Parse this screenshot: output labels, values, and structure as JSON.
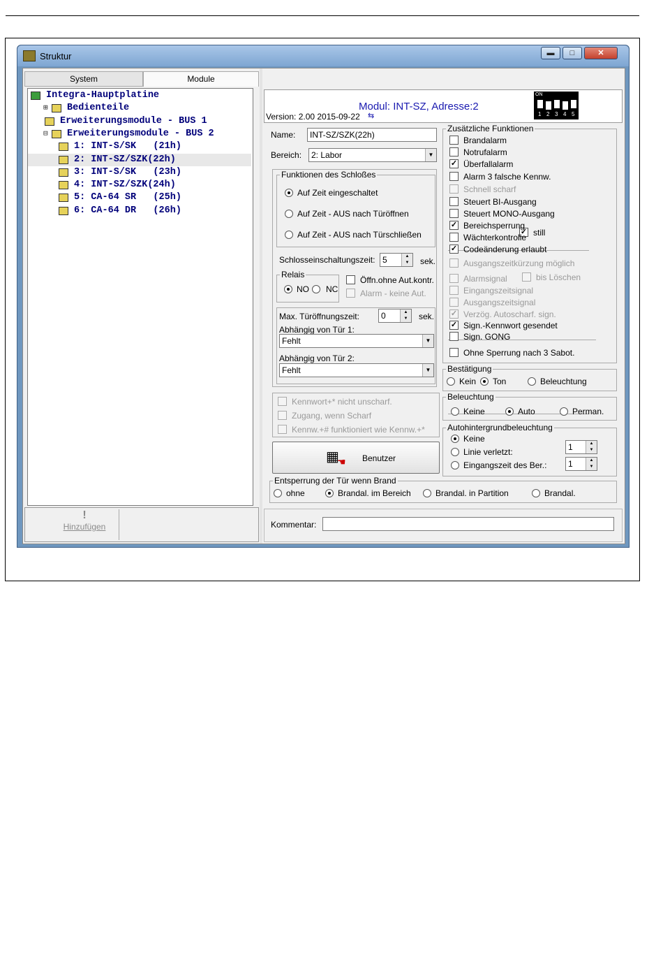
{
  "window": {
    "title": "Struktur",
    "min": "▬",
    "max": "□",
    "close": "✕"
  },
  "tabs": [
    "System",
    "Module"
  ],
  "tree": [
    {
      "text": "Integra-Hauptplatine",
      "icon": "mainboard-icon",
      "prefix": ""
    },
    {
      "text": "Bedienteile",
      "icon": "keypad-icon",
      "prefix": "⊞"
    },
    {
      "text": "Erweiterungsmodule - BUS 1",
      "icon": "bus-icon",
      "prefix": ""
    },
    {
      "text": "Erweiterungsmodule - BUS 2",
      "icon": "bus-icon",
      "prefix": "⊟"
    },
    {
      "text": "1: INT-S/SK   (21h)",
      "icon": "module-icon",
      "prefix": ""
    },
    {
      "text": "2: INT-SZ/SZK(22h)",
      "icon": "module-lock-icon",
      "prefix": ""
    },
    {
      "text": "3: INT-S/SK   (23h)",
      "icon": "module-icon",
      "prefix": ""
    },
    {
      "text": "4: INT-SZ/SZK(24h)",
      "icon": "module-lock-icon",
      "prefix": ""
    },
    {
      "text": "5: CA-64 SR   (25h)",
      "icon": "siren-icon",
      "prefix": ""
    },
    {
      "text": "6: CA-64 DR   (26h)",
      "icon": "door-icon",
      "prefix": ""
    }
  ],
  "add_button": "Hinzufügen",
  "header": {
    "module": "Modul: INT-SZ, Adresse:2",
    "version": "Version: 2.00 2015-09-22",
    "dip_on": "ON",
    "dip_numbers": [
      "1",
      "2",
      "3",
      "4",
      "5"
    ]
  },
  "name": {
    "label": "Name:",
    "value": "INT-SZ/SZK(22h)"
  },
  "bereich": {
    "label": "Bereich:",
    "value": "2: Labor"
  },
  "lockfunc": {
    "title": "Funktionen des Schloßes",
    "options": [
      "Auf Zeit eingeschaltet",
      "Auf Zeit - AUS nach Türöffnen",
      "Auf Zeit - AUS nach Türschließen"
    ],
    "selected": 0
  },
  "lock_time": {
    "label": "Schlosseinschaltungszeit:",
    "value": "5",
    "unit": "sek."
  },
  "relais": {
    "title": "Relais",
    "no": "NO",
    "nc": "NC",
    "opt1": "Öffn.ohne Aut.kontr.",
    "opt2": "Alarm - keine Aut."
  },
  "door": {
    "label": "Max. Türöffnungszeit:",
    "value": "0",
    "unit": "sek.",
    "dep1_label": "Abhängig von Tür 1:",
    "dep1": "Fehlt",
    "dep2_label": "Abhängig von Tür 2:",
    "dep2": "Fehlt"
  },
  "lowchecks": [
    "Kennwort+* nicht unscharf.",
    "Zugang, wenn Scharf",
    "Kennw.+# funktioniert wie Kennw.+*"
  ],
  "benutzer": "Benutzer",
  "zf": {
    "title": "Zusätzliche Funktionen",
    "items": [
      {
        "label": "Brandalarm",
        "checked": false,
        "disabled": false
      },
      {
        "label": "Notrufalarm",
        "checked": false,
        "disabled": false
      },
      {
        "label": "Überfallalarm",
        "checked": true,
        "disabled": false
      },
      {
        "label": "Alarm 3 falsche Kennw.",
        "checked": false,
        "disabled": false
      },
      {
        "label": "Schnell scharf",
        "checked": false,
        "disabled": true
      },
      {
        "label": "Steuert BI-Ausgang",
        "checked": false,
        "disabled": false
      },
      {
        "label": "Steuert MONO-Ausgang",
        "checked": false,
        "disabled": false
      },
      {
        "label": "Bereichsperrung",
        "checked": true,
        "disabled": false
      },
      {
        "label": "Wächterkontrolle",
        "checked": false,
        "disabled": false
      },
      {
        "label": "Codeänderung erlaubt",
        "checked": true,
        "disabled": false
      },
      {
        "label": "Ausgangszeitkürzung möglich",
        "checked": false,
        "disabled": true
      },
      {
        "label": "Alarmsignal",
        "checked": false,
        "disabled": true
      },
      {
        "label": "Eingangszeitsignal",
        "checked": false,
        "disabled": true
      },
      {
        "label": "Ausgangszeitsignal",
        "checked": false,
        "disabled": true
      },
      {
        "label": "Verzög. Autoscharf. sign.",
        "checked": true,
        "disabled": true
      },
      {
        "label": "Sign.-Kennwort gesendet",
        "checked": true,
        "disabled": false
      },
      {
        "label": "Sign. GONG",
        "checked": false,
        "disabled": false
      },
      {
        "label": "Ohne Sperrung nach 3 Sabot.",
        "checked": false,
        "disabled": false
      }
    ],
    "still": "still",
    "bis_loeschen": "bis Löschen"
  },
  "bestaetigung": {
    "title": "Bestätigung",
    "options": [
      "Kein",
      "Ton",
      "Beleuchtung"
    ],
    "selected": 1
  },
  "beleuchtung": {
    "title": "Beleuchtung",
    "options": [
      "Keine",
      "Auto",
      "Perman."
    ],
    "selected": 1
  },
  "autobg": {
    "title": "Autohintergrundbeleuchtung",
    "options": [
      "Keine",
      "Linie verletzt:",
      "Eingangszeit des Ber.:"
    ],
    "selected": 0,
    "v1": "1",
    "v2": "1"
  },
  "brand": {
    "title": "Entsperrung der Tür wenn Brand",
    "options": [
      "ohne",
      "Brandal. im Bereich",
      "Brandal. in Partition",
      "Brandal."
    ],
    "selected": 1
  },
  "kommentar": {
    "label": "Kommentar:",
    "value": ""
  },
  "colors": {
    "tree_text": "#00007a",
    "module_title": "#1a1ab0",
    "titlebar": "#7ea6d2"
  }
}
